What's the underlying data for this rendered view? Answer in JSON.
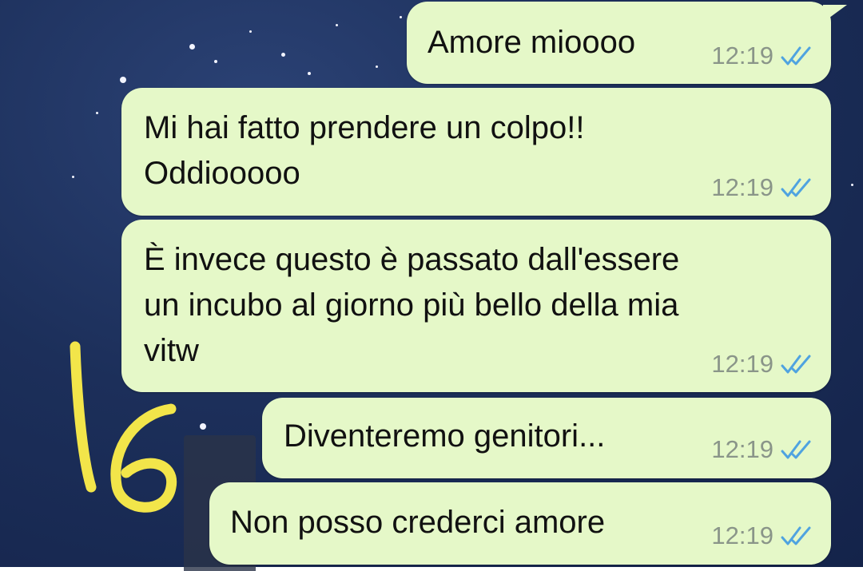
{
  "colors": {
    "bubble": "#e5f8c8",
    "background": "#1c2f5a",
    "timestamp": "#8a9589",
    "read_ticks": "#4fa3e0",
    "annotation": "#f2e54a"
  },
  "messages": [
    {
      "text": "Amore mioooo",
      "time": "12:19",
      "status": "read-double-check-icon"
    },
    {
      "text": "Mi hai fatto prendere un colpo!!\nOddiooooo",
      "time": "12:19",
      "status": "read-double-check-icon"
    },
    {
      "text": "È invece questo è passato dall'essere\nun incubo al giorno più bello della mia\nvitw",
      "time": "12:19",
      "status": "read-double-check-icon"
    },
    {
      "text": "Diventeremo genitori...",
      "time": "12:19",
      "status": "read-double-check-icon"
    },
    {
      "text": "Non posso crederci amore",
      "time": "12:19",
      "status": "read-double-check-icon"
    }
  ],
  "annotation": {
    "icon": "handwritten-number-annotation"
  }
}
